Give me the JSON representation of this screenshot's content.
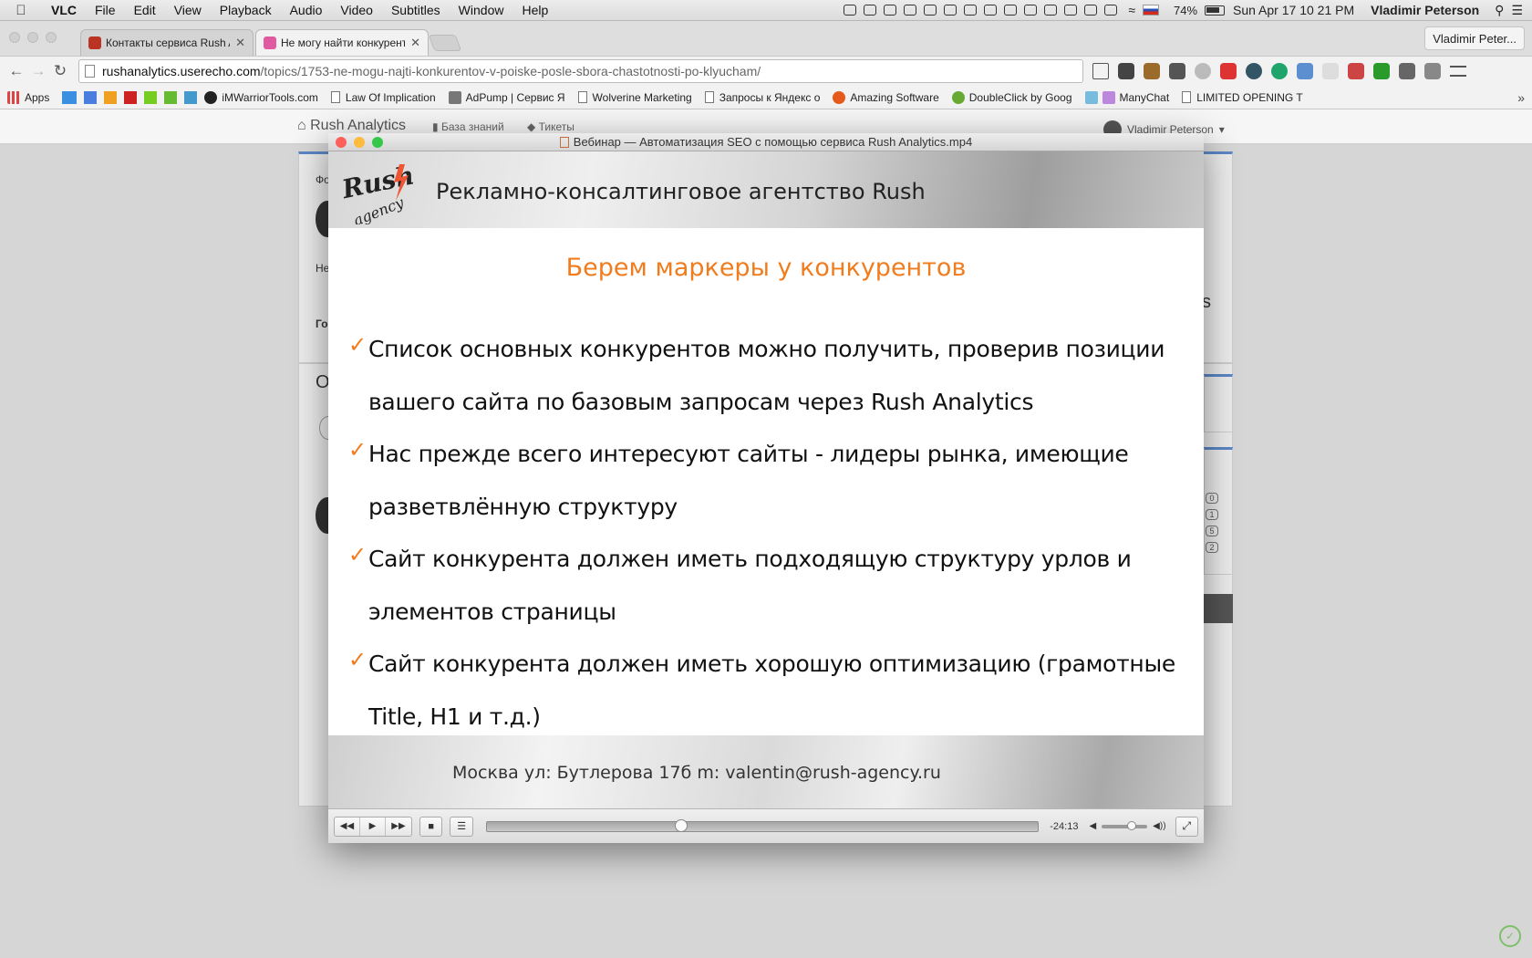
{
  "menubar": {
    "app": "VLC",
    "items": [
      "File",
      "Edit",
      "View",
      "Playback",
      "Audio",
      "Video",
      "Subtitles",
      "Window",
      "Help"
    ],
    "battery": "74%",
    "clock": "Sun Apr 17  10 21 PM",
    "user": "Vladimir Peterson"
  },
  "browser": {
    "tabs": [
      {
        "title": "Контакты сервиса Rush A",
        "active": false
      },
      {
        "title": "Не могу найти конкурент",
        "active": true
      }
    ],
    "profile": "Vladimir Peter...",
    "url_host": "rushanalytics.userecho.com",
    "url_path": "/topics/1753-ne-mogu-najti-konkurentov-v-poiske-posle-sbora-chastotnosti-po-klyucham/",
    "bookmarks": [
      "Apps",
      "iMWarriorTools.com",
      "Law Of Implication",
      "AdPump | Сервис Я",
      "Wolverine Marketing",
      "Запросы к Яндекс о",
      "Amazing Software",
      "DoubleClick by Goog",
      "ManyChat",
      "LIMITED OPENING T"
    ],
    "more": "»"
  },
  "site": {
    "brand": "Rush Analytics",
    "nav_kb": "База знаний",
    "nav_tickets": "Тикеты",
    "user": "Vladimir Peterson",
    "fragments": {
      "f1": "Фо",
      "f2": "Не",
      "f3": "Го",
      "f4": "О",
      "f5": "s"
    },
    "counts": [
      "0",
      "1",
      "5",
      "2"
    ]
  },
  "vlc": {
    "title": "Вебинар — Автоматизация SEO с помощью сервиса Rush Analytics.mp4",
    "time": "-24:13",
    "progress": 0.35,
    "volume": 0.7
  },
  "slide": {
    "header": "Рекламно-консалтинговое агентство Rush",
    "logo": "Rush agency",
    "title": "Берем маркеры у конкурентов",
    "bullets": [
      "Список основных конкурентов можно получить, проверив позиции вашего сайта по базовым запросам через Rush Analytics",
      "Нас прежде всего интересуют сайты - лидеры рынка, имеющие разветвлённую структуру",
      "Сайт конкурента должен иметь подходящую структуру урлов и элементов страницы",
      "Сайт конкурента должен иметь хорошую оптимизацию (грамотные Title, H1 и т.д.)"
    ],
    "footer": "Москва ул: Бутлерова 17б  m: valentin@rush-agency.ru"
  },
  "colors": {
    "accent_orange": "#f07c1e",
    "close": "#fc605c",
    "minimize": "#fdbc40",
    "zoom": "#34c84a"
  }
}
